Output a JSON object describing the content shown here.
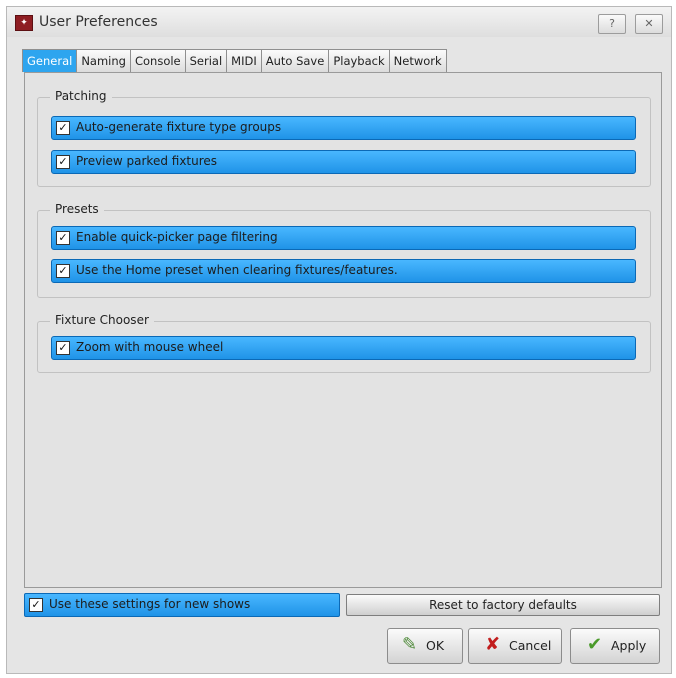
{
  "window": {
    "title": "User Preferences",
    "help_glyph": "?",
    "close_glyph": "✕"
  },
  "tabs": [
    {
      "label": "General"
    },
    {
      "label": "Naming"
    },
    {
      "label": "Console"
    },
    {
      "label": "Serial"
    },
    {
      "label": "MIDI"
    },
    {
      "label": "Auto Save"
    },
    {
      "label": "Playback"
    },
    {
      "label": "Network"
    }
  ],
  "active_tab": "General",
  "groups": {
    "patching": {
      "title": "Patching",
      "options": [
        {
          "label": "Auto-generate fixture type groups",
          "checked": true
        },
        {
          "label": "Preview parked fixtures",
          "checked": true
        }
      ]
    },
    "presets": {
      "title": "Presets",
      "options": [
        {
          "label": "Enable quick-picker page filtering",
          "checked": true
        },
        {
          "label": "Use the Home preset when clearing fixtures/features.",
          "checked": true
        }
      ]
    },
    "fixture_chooser": {
      "title": "Fixture Chooser",
      "options": [
        {
          "label": "Zoom with mouse wheel",
          "checked": true
        }
      ]
    }
  },
  "footer": {
    "use_settings_label": "Use these settings for new shows",
    "use_settings_checked": true,
    "reset_label": "Reset to factory defaults",
    "ok_label": "OK",
    "cancel_label": "Cancel",
    "apply_label": "Apply"
  },
  "check_glyph": "✓",
  "icons": {
    "ok": "pencil-check-icon",
    "cancel": "red-x-icon",
    "apply": "green-check-icon"
  },
  "colors": {
    "accent": "#2ea5ef",
    "dialog_bg": "#e3e3e3",
    "cancel_red": "#c21d1d",
    "apply_green": "#4a9a2a"
  }
}
